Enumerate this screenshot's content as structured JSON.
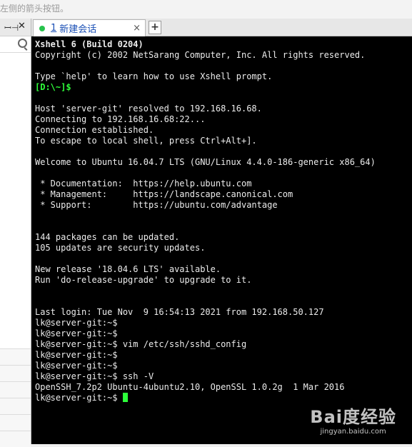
{
  "topbar": {
    "hint": "左侧的箭头按钮。"
  },
  "left_panel": {
    "pin_icon": "pin-icon",
    "close_icon": "close-icon"
  },
  "tabs": [
    {
      "number": "1",
      "title": "新建会话",
      "close": "×"
    }
  ],
  "new_tab_label": "+",
  "terminal": {
    "lines": [
      {
        "text": "Xshell 6 (Build 0204)",
        "style": "bold"
      },
      {
        "text": "Copyright (c) 2002 NetSarang Computer, Inc. All rights reserved.",
        "style": ""
      },
      {
        "text": "",
        "style": ""
      },
      {
        "text": "Type `help' to learn how to use Xshell prompt.",
        "style": ""
      },
      {
        "text": "[D:\\~]$",
        "style": "green"
      },
      {
        "text": "",
        "style": ""
      },
      {
        "text": "Host 'server-git' resolved to 192.168.16.68.",
        "style": ""
      },
      {
        "text": "Connecting to 192.168.16.68:22...",
        "style": ""
      },
      {
        "text": "Connection established.",
        "style": ""
      },
      {
        "text": "To escape to local shell, press Ctrl+Alt+].",
        "style": ""
      },
      {
        "text": "",
        "style": ""
      },
      {
        "text": "Welcome to Ubuntu 16.04.7 LTS (GNU/Linux 4.4.0-186-generic x86_64)",
        "style": ""
      },
      {
        "text": "",
        "style": ""
      },
      {
        "text": " * Documentation:  https://help.ubuntu.com",
        "style": ""
      },
      {
        "text": " * Management:     https://landscape.canonical.com",
        "style": ""
      },
      {
        "text": " * Support:        https://ubuntu.com/advantage",
        "style": ""
      },
      {
        "text": "",
        "style": ""
      },
      {
        "text": "",
        "style": ""
      },
      {
        "text": "144 packages can be updated.",
        "style": ""
      },
      {
        "text": "105 updates are security updates.",
        "style": ""
      },
      {
        "text": "",
        "style": ""
      },
      {
        "text": "New release '18.04.6 LTS' available.",
        "style": ""
      },
      {
        "text": "Run 'do-release-upgrade' to upgrade to it.",
        "style": ""
      },
      {
        "text": "",
        "style": ""
      },
      {
        "text": "",
        "style": ""
      },
      {
        "text": "Last login: Tue Nov  9 16:54:13 2021 from 192.168.50.127",
        "style": ""
      },
      {
        "text": "lk@server-git:~$",
        "style": ""
      },
      {
        "text": "lk@server-git:~$",
        "style": ""
      },
      {
        "text": "lk@server-git:~$ vim /etc/ssh/sshd_config",
        "style": ""
      },
      {
        "text": "lk@server-git:~$",
        "style": ""
      },
      {
        "text": "lk@server-git:~$",
        "style": ""
      },
      {
        "text": "lk@server-git:~$ ssh -V",
        "style": ""
      },
      {
        "text": "OpenSSH_7.2p2 Ubuntu-4ubuntu2.10, OpenSSL 1.0.2g  1 Mar 2016",
        "style": ""
      }
    ],
    "prompt": "lk@server-git:~$ "
  },
  "watermark": {
    "brand": "Bai度经验",
    "url": "jingyan.baidu.com"
  },
  "colors": {
    "terminal_bg": "#000000",
    "prompt_green": "#2fff3a",
    "tab_text": "#1a4fb5",
    "status_dot": "#27c24c"
  }
}
